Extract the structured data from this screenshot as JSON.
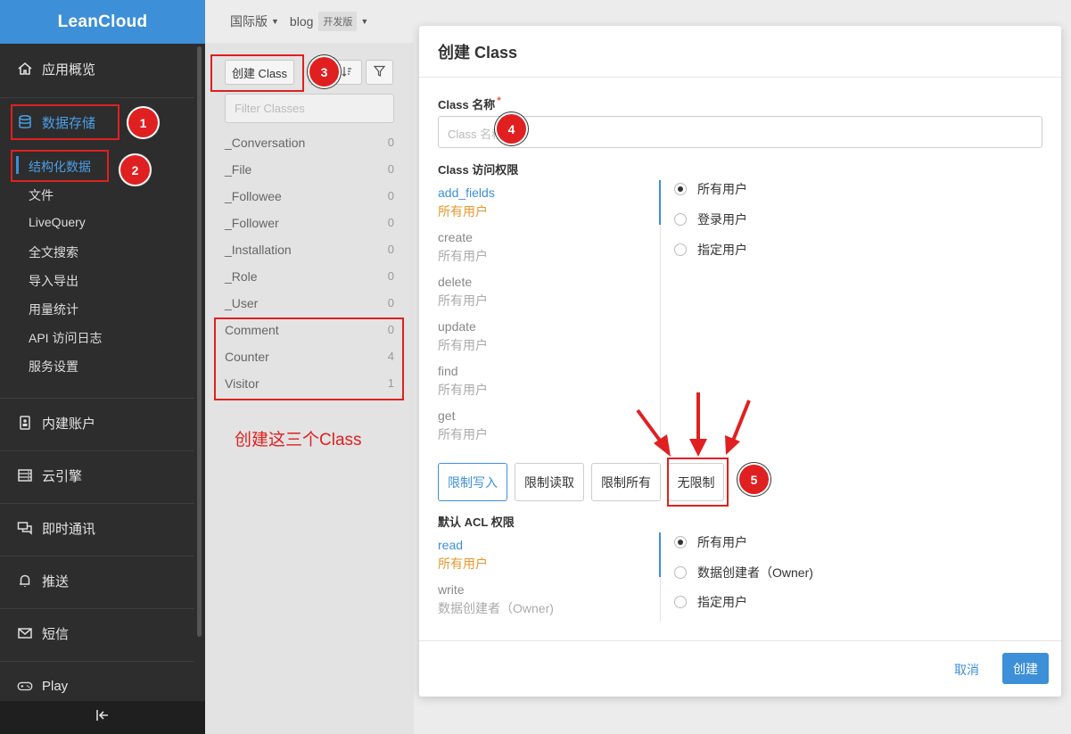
{
  "sidebar": {
    "logo": "LeanCloud",
    "items": [
      {
        "label": "应用概览",
        "icon": "home-icon"
      },
      {
        "label": "数据存储",
        "icon": "database-icon"
      },
      {
        "label": "内建账户",
        "icon": "id-card-icon"
      },
      {
        "label": "云引擎",
        "icon": "server-icon"
      },
      {
        "label": "即时通讯",
        "icon": "chat-icon"
      },
      {
        "label": "推送",
        "icon": "bell-icon"
      },
      {
        "label": "短信",
        "icon": "mail-icon"
      },
      {
        "label": "Play",
        "icon": "gamepad-icon"
      }
    ],
    "sub_items": [
      "结构化数据",
      "文件",
      "LiveQuery",
      "全文搜索",
      "导入导出",
      "用量统计",
      "API 访问日志",
      "服务设置"
    ],
    "collapse_icon": "collapse-left-icon"
  },
  "topbar": {
    "region": "国际版",
    "app": "blog",
    "badge": "开发版"
  },
  "class_list": {
    "create_button": "创建 Class",
    "filter_placeholder": "Filter Classes",
    "rows": [
      {
        "name": "_Conversation",
        "count": "0"
      },
      {
        "name": "_File",
        "count": "0"
      },
      {
        "name": "_Followee",
        "count": "0"
      },
      {
        "name": "_Follower",
        "count": "0"
      },
      {
        "name": "_Installation",
        "count": "0"
      },
      {
        "name": "_Role",
        "count": "0"
      },
      {
        "name": "_User",
        "count": "0"
      },
      {
        "name": "Comment",
        "count": "0"
      },
      {
        "name": "Counter",
        "count": "4"
      },
      {
        "name": "Visitor",
        "count": "1"
      }
    ]
  },
  "modal": {
    "title": "创建 Class",
    "name_label": "Class 名称",
    "required_mark": "*",
    "name_placeholder": "Class 名称",
    "acl_label": "Class 访问权限",
    "permissions": [
      {
        "op": "add_fields",
        "who": "所有用户"
      },
      {
        "op": "create",
        "who": "所有用户"
      },
      {
        "op": "delete",
        "who": "所有用户"
      },
      {
        "op": "update",
        "who": "所有用户"
      },
      {
        "op": "find",
        "who": "所有用户"
      },
      {
        "op": "get",
        "who": "所有用户"
      }
    ],
    "perm_options": [
      "所有用户",
      "登录用户",
      "指定用户"
    ],
    "presets": [
      "限制写入",
      "限制读取",
      "限制所有",
      "无限制"
    ],
    "default_acl_label": "默认 ACL 权限",
    "default_acl": [
      {
        "op": "read",
        "who": "所有用户"
      },
      {
        "op": "write",
        "who": "数据创建者（Owner)"
      }
    ],
    "default_options": [
      "所有用户",
      "数据创建者（Owner)",
      "指定用户"
    ],
    "cancel": "取消",
    "create": "创建"
  },
  "annotations": {
    "steps": [
      "1",
      "2",
      "3",
      "4",
      "5"
    ],
    "note": "创建这三个Class",
    "color": "#e02020"
  },
  "colors": {
    "brand": "#3d8fd8",
    "sidebar_bg": "#2d2d2d",
    "warning": "#e8962c"
  }
}
